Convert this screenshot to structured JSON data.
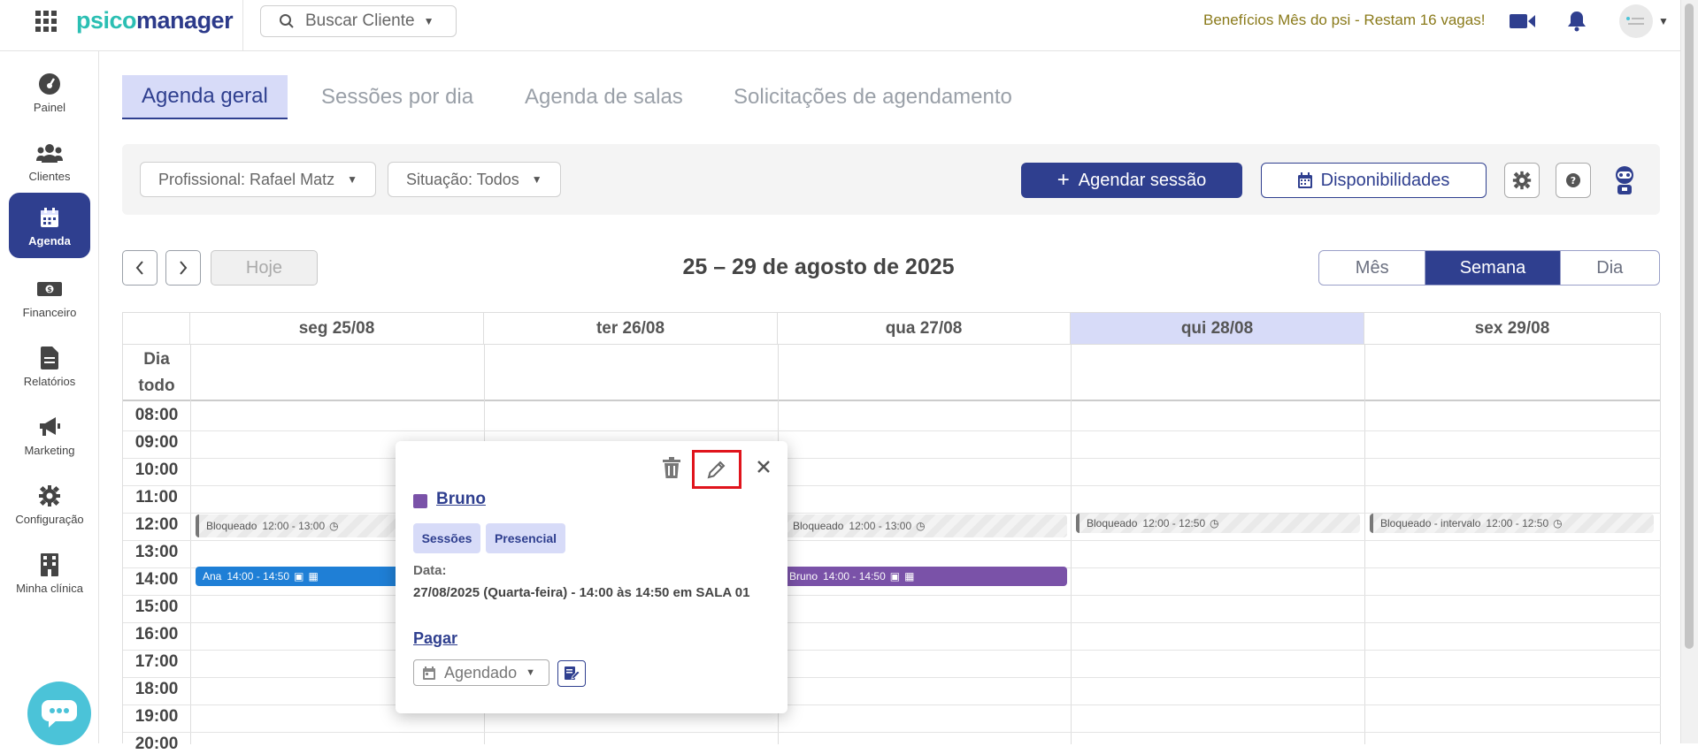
{
  "brand": {
    "logo_part1": "psico",
    "logo_part2": "manager"
  },
  "search": {
    "label": "Buscar Cliente"
  },
  "promo": {
    "text": "Benefícios Mês do psi - Restam 16 vagas!"
  },
  "sidebar": {
    "items": [
      {
        "label": "Painel",
        "icon": "gauge-icon"
      },
      {
        "label": "Clientes",
        "icon": "users-icon"
      },
      {
        "label": "Agenda",
        "icon": "calendar-icon",
        "active": true
      },
      {
        "label": "Financeiro",
        "icon": "money-icon"
      },
      {
        "label": "Relatórios",
        "icon": "document-icon"
      },
      {
        "label": "Marketing",
        "icon": "megaphone-icon"
      },
      {
        "label": "Configuração",
        "icon": "gear-icon"
      },
      {
        "label": "Minha clínica",
        "icon": "building-icon"
      }
    ]
  },
  "tabs": [
    {
      "label": "Agenda geral",
      "active": true
    },
    {
      "label": "Sessões por dia"
    },
    {
      "label": "Agenda de salas"
    },
    {
      "label": "Solicitações de agendamento"
    }
  ],
  "filters": {
    "professional": "Profissional: Rafael Matz",
    "status": "Situação: Todos",
    "schedule_button": "Agendar sessão",
    "availability_button": "Disponibilidades"
  },
  "calendar": {
    "today_button": "Hoje",
    "range_title": "25 – 29 de agosto de 2025",
    "views": [
      "Mês",
      "Semana",
      "Dia"
    ],
    "active_view": "Semana",
    "allday_label_1": "Dia",
    "allday_label_2": "todo",
    "days": [
      {
        "label": "seg 25/08"
      },
      {
        "label": "ter 26/08"
      },
      {
        "label": "qua 27/08"
      },
      {
        "label": "qui 28/08",
        "today": true
      },
      {
        "label": "sex 29/08"
      }
    ],
    "times": [
      "08:00",
      "09:00",
      "10:00",
      "11:00",
      "12:00",
      "13:00",
      "14:00",
      "15:00",
      "16:00",
      "17:00",
      "18:00",
      "19:00",
      "20:00"
    ],
    "events": {
      "mon_block": {
        "title": "Bloqueado",
        "time": "12:00 - 13:00"
      },
      "wed_block": {
        "title": "Bloqueado",
        "time": "12:00 - 13:00"
      },
      "thu_block": {
        "title": "Bloqueado",
        "time": "12:00 - 12:50"
      },
      "fri_block": {
        "title": "Bloqueado - intervalo",
        "time": "12:00 - 12:50"
      },
      "mon_ana": {
        "title": "Ana",
        "time": "14:00 - 14:50"
      },
      "wed_bruno": {
        "title": "Bruno",
        "time": "14:00 - 14:50"
      }
    }
  },
  "popup": {
    "client_name": "Bruno",
    "chips": [
      "Sessões",
      "Presencial"
    ],
    "date_label": "Data:",
    "date_value": "27/08/2025 (Quarta-feira) - 14:00 às 14:50 em SALA 01",
    "pay_link": "Pagar",
    "status": "Agendado"
  },
  "colors": {
    "primary": "#2f3f8f",
    "today_bg": "#d7dbf8",
    "event_blue": "#1f7fd6",
    "event_purple": "#7a52a8",
    "highlight": "#e0141c"
  }
}
